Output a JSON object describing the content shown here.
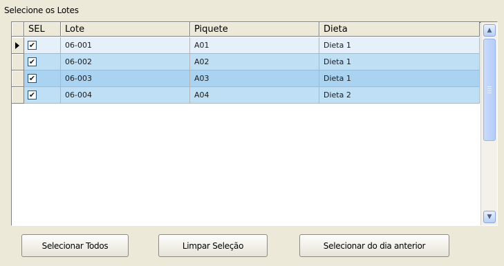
{
  "group": {
    "title": "Selecione os Lotes"
  },
  "grid": {
    "columns": [
      "SEL",
      "Lote",
      "Piquete",
      "Dieta"
    ],
    "rows": [
      {
        "sel": "✔",
        "lote": "06-001",
        "piquete": "A01",
        "dieta": "Dieta 1",
        "current": true
      },
      {
        "sel": "✔",
        "lote": "06-002",
        "piquete": "A02",
        "dieta": "Dieta 1",
        "current": false
      },
      {
        "sel": "✔",
        "lote": "06-003",
        "piquete": "A03",
        "dieta": "Dieta 1",
        "current": false
      },
      {
        "sel": "✔",
        "lote": "06-004",
        "piquete": "A04",
        "dieta": "Dieta 2",
        "current": false
      }
    ],
    "scroll_up_icon": "▲",
    "scroll_down_icon": "▼"
  },
  "buttons": {
    "select_all": "Selecionar Todos",
    "clear_selection": "Limpar Seleção",
    "select_previous_day": "Selecionar do dia anterior"
  },
  "colors": {
    "row_selected": "#e6f0fa",
    "row_highlight": "#bfdff5",
    "scrollbar_thumb": "#c9dbfb"
  }
}
